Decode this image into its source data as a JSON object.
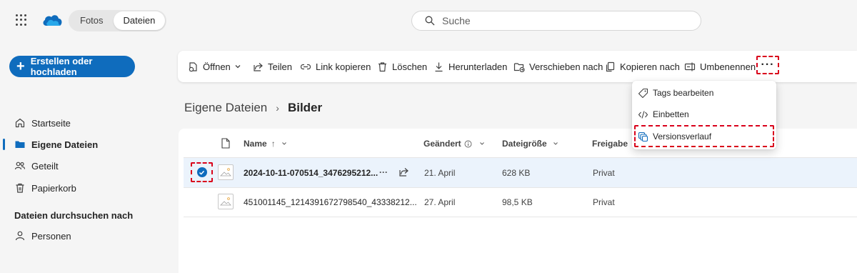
{
  "topbar": {
    "tabs": [
      {
        "label": "Fotos",
        "active": false
      },
      {
        "label": "Dateien",
        "active": true
      }
    ],
    "search": {
      "placeholder": "Suche",
      "value": ""
    }
  },
  "sidebar": {
    "create_label": "Erstellen oder hochladen",
    "items": [
      {
        "label": "Startseite",
        "icon": "home-icon",
        "active": false
      },
      {
        "label": "Eigene Dateien",
        "icon": "folder-icon",
        "active": true
      },
      {
        "label": "Geteilt",
        "icon": "people-icon",
        "active": false
      },
      {
        "label": "Papierkorb",
        "icon": "trash-icon",
        "active": false
      }
    ],
    "browse_heading": "Dateien durchsuchen nach",
    "browse_items": [
      {
        "label": "Personen",
        "icon": "person-icon"
      }
    ]
  },
  "toolbar": {
    "open": "Öffnen",
    "share": "Teilen",
    "copy_link": "Link kopieren",
    "delete": "Löschen",
    "download": "Herunterladen",
    "move_to": "Verschieben nach",
    "copy_to": "Kopieren nach",
    "rename": "Umbenennen",
    "more": "···"
  },
  "more_menu": {
    "items": [
      {
        "label": "Tags bearbeiten",
        "icon": "tag-icon"
      },
      {
        "label": "Einbetten",
        "icon": "code-icon"
      },
      {
        "label": "Versionsverlauf",
        "icon": "version-history-icon",
        "highlighted": true
      }
    ]
  },
  "breadcrumb": {
    "parent": "Eigene Dateien",
    "separator": "›",
    "current": "Bilder"
  },
  "file_list": {
    "columns": {
      "name": "Name",
      "name_sort": "↑",
      "modified": "Geändert",
      "size": "Dateigröße",
      "sharing": "Freigabe"
    },
    "rows": [
      {
        "name": "2024-10-11-070514_3476295212...",
        "modified": "21. April",
        "size": "628 KB",
        "sharing": "Privat",
        "selected": true,
        "more": "···"
      },
      {
        "name": "451001145_1214391672798540_43338212...",
        "modified": "27. April",
        "size": "98,5 KB",
        "sharing": "Privat",
        "selected": false
      }
    ]
  },
  "colors": {
    "accent": "#0f6cbd",
    "selected_row": "#ebf3fc",
    "highlight_dash": "#d9001b"
  }
}
